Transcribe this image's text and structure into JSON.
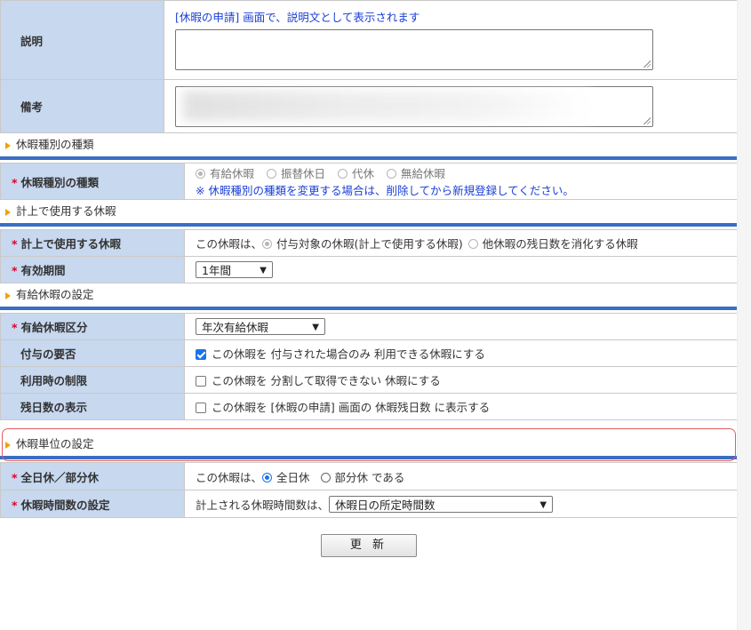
{
  "description": {
    "label": "説明",
    "hint": "[休暇の申請] 画面で、説明文として表示されます",
    "value": ""
  },
  "remarks": {
    "label": "備考"
  },
  "sections": {
    "type": "休暇種別の種類",
    "usage": "計上で使用する休暇",
    "paid": "有給休暇の設定",
    "unit": "休暇単位の設定"
  },
  "leave_type": {
    "label": "休暇種別の種類",
    "options": [
      "有給休暇",
      "振替休日",
      "代休",
      "無給休暇"
    ],
    "selected": "有給休暇",
    "note": "※ 休暇種別の種類を変更する場合は、削除してから新規登録してください。"
  },
  "usage_leave": {
    "label": "計上で使用する休暇",
    "prefix": "この休暇は、",
    "options": [
      "付与対象の休暇(計上で使用する休暇)",
      "他休暇の残日数を消化する休暇"
    ]
  },
  "valid_period": {
    "label": "有効期間",
    "value": "1年間"
  },
  "paid_category": {
    "label": "有給休暇区分",
    "value": "年次有給休暇"
  },
  "grant_required": {
    "label": "付与の要否",
    "text": "この休暇を 付与された場合のみ 利用できる休暇にする",
    "checked": true
  },
  "usage_limit": {
    "label": "利用時の制限",
    "text": "この休暇を 分割して取得できない 休暇にする",
    "checked": false
  },
  "remaining_display": {
    "label": "残日数の表示",
    "text": "この休暇を [休暇の申請] 画面の 休暇残日数 に表示する",
    "checked": false
  },
  "day_unit": {
    "label": "全日休／部分休",
    "prefix": "この休暇は、",
    "options": [
      "全日休",
      "部分休"
    ],
    "suffix": "である",
    "selected": "全日休"
  },
  "hours_setting": {
    "label": "休暇時間数の設定",
    "prefix": "計上される休暇時間数は、",
    "value": "休暇日の所定時間数"
  },
  "submit": {
    "label": "更 新"
  },
  "colors": {
    "label_bg": "#c7d8ef",
    "section_bar": "#3a6ec6",
    "required": "#e0002d",
    "hint": "#1a3fd6",
    "highlight": "#e06060"
  }
}
